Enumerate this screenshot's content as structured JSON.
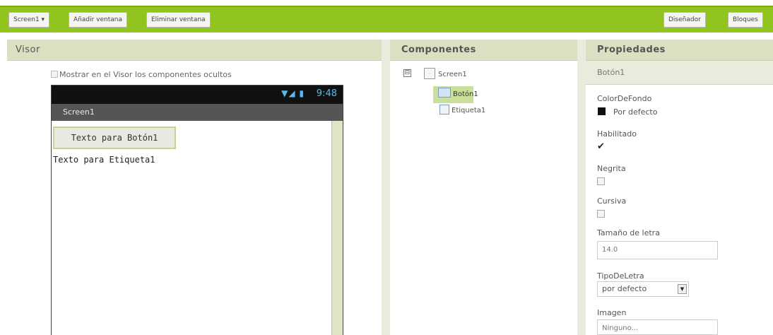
{
  "toolbar": {
    "screen_selector": "Screen1 ▾",
    "add_window": "Añadir ventana",
    "remove_window": "Eliminar ventana",
    "designer": "Diseñador",
    "blocks": "Bloques"
  },
  "viewer": {
    "title": "Visor",
    "show_hidden": "Mostrar en el Visor los componentes ocultos",
    "phone": {
      "status_icons": "▼◢ ▮",
      "time": "9:48",
      "screen_title": "Screen1",
      "button_text": "Texto para Botón1",
      "label_text": "Texto para Etiqueta1"
    }
  },
  "components": {
    "title": "Componentes",
    "collapse": "⊟",
    "tree": [
      {
        "name": "Screen1"
      },
      {
        "name": "Botón1"
      },
      {
        "name": "Etiqueta1"
      }
    ]
  },
  "properties": {
    "title": "Propiedades",
    "component": "Botón1",
    "bg_color_label": "ColorDeFondo",
    "bg_color_value": "Por defecto",
    "enabled_label": "Habilitado",
    "enabled_check": "✔",
    "bold_label": "Negrita",
    "italic_label": "Cursiva",
    "font_size_label": "Tamaño de letra",
    "font_size_value": "14.0",
    "font_type_label": "TipoDeLetra",
    "font_type_value": "por defecto",
    "image_label": "Imagen",
    "image_value": "Ninguno..."
  },
  "colors": {
    "toolbar_green": "#92c41f",
    "panel_header": "#d9e1c2",
    "selected_node": "#c8e09a",
    "status_blue": "#59b9ee"
  }
}
